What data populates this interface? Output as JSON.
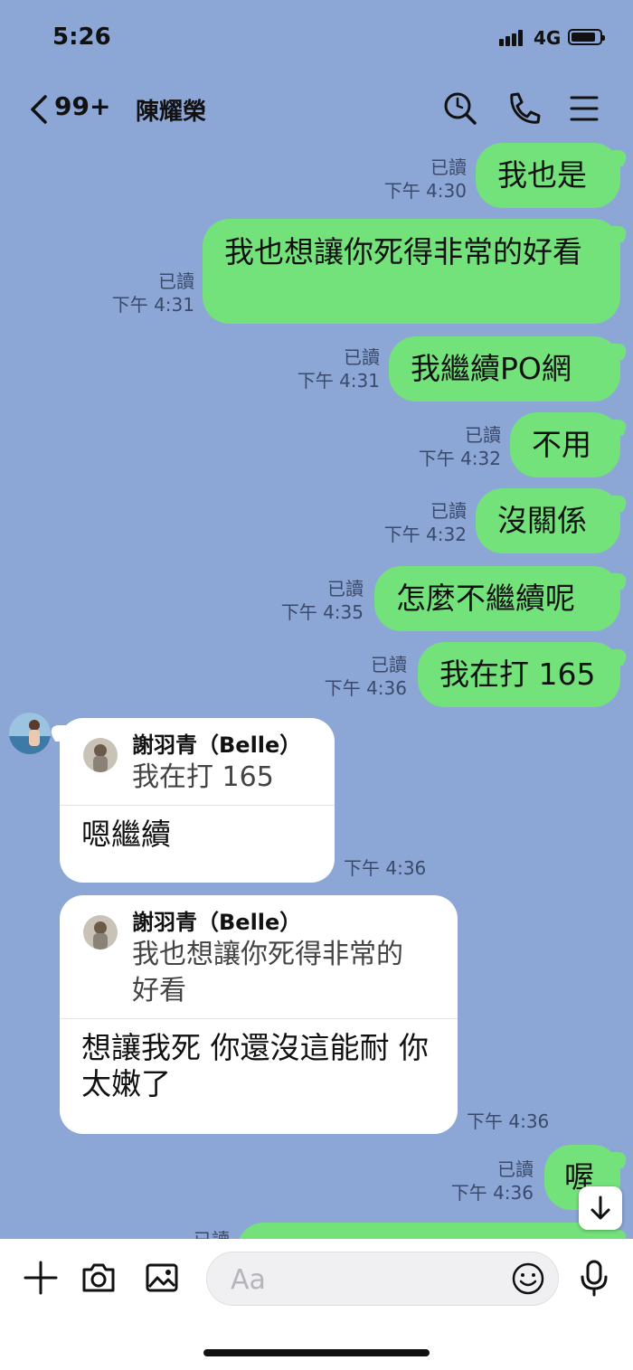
{
  "status": {
    "time": "5:26",
    "network": "4G"
  },
  "header": {
    "unread_count": "99+",
    "title": "陳耀榮"
  },
  "messages_out": [
    {
      "text": "我也是",
      "read": "已讀",
      "time": "下午 4:30"
    },
    {
      "text": "我也想讓你死得非常的好看",
      "read": "已讀",
      "time": "下午 4:31"
    },
    {
      "text": "我繼續PO網",
      "read": "已讀",
      "time": "下午 4:31"
    },
    {
      "text": "不用",
      "read": "已讀",
      "time": "下午 4:32"
    },
    {
      "text": "沒關係",
      "read": "已讀",
      "time": "下午 4:32"
    },
    {
      "text": "怎麼不繼續呢",
      "read": "已讀",
      "time": "下午 4:35"
    },
    {
      "text": "我在打 165",
      "read": "已讀",
      "time": "下午 4:36"
    },
    {
      "text": "喔",
      "read": "已讀",
      "time": "下午 4:36"
    }
  ],
  "messages_in": [
    {
      "quote_name": "謝羽青（Belle）",
      "quote_text": "我在打 165",
      "reply": "嗯繼續",
      "time": "下午 4:36"
    },
    {
      "quote_name": "謝羽青（Belle）",
      "quote_text": "我也想讓你死得非常的好看",
      "reply": "想讓我死 你還沒這能耐 你太嫩了",
      "time": "下午 4:36"
    }
  ],
  "partial_bottom": {
    "read": "已讀"
  },
  "input": {
    "placeholder": "Aa"
  },
  "colors": {
    "background": "#8ca6d6",
    "outgoing_bubble": "#74e27a",
    "incoming_bubble": "#ffffff"
  }
}
